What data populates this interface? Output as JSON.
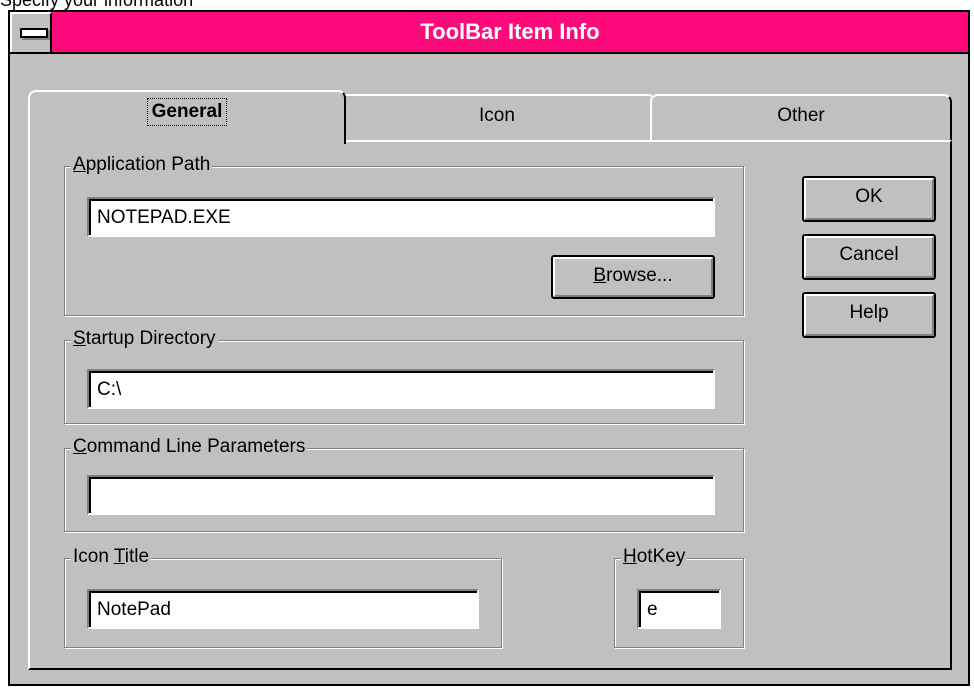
{
  "caption": "Specify your information",
  "window": {
    "title": "ToolBar Item Info"
  },
  "tabs": [
    {
      "label": "General",
      "active": true
    },
    {
      "label": "Icon",
      "active": false
    },
    {
      "label": "Other",
      "active": false
    }
  ],
  "groups": {
    "app_path": {
      "label_first": "A",
      "label_rest": "pplication Path",
      "value": "NOTEPAD.EXE",
      "browse_first": "B",
      "browse_rest": "rowse..."
    },
    "startup_dir": {
      "label_first": "S",
      "label_rest": "tartup Directory",
      "value": "C:\\"
    },
    "cmd_params": {
      "label_first": "C",
      "label_rest": "ommand Line Parameters",
      "value": ""
    },
    "icon_title": {
      "label_pre": "Icon ",
      "label_ul": "T",
      "label_rest": "itle",
      "value": "NotePad"
    },
    "hotkey": {
      "label_first": "H",
      "label_rest": "otKey",
      "value": "e"
    }
  },
  "buttons": {
    "ok": "OK",
    "cancel": "Cancel",
    "help": "Help"
  },
  "colors": {
    "titlebar": "#ff0a7a",
    "face": "#c0c0c0"
  }
}
